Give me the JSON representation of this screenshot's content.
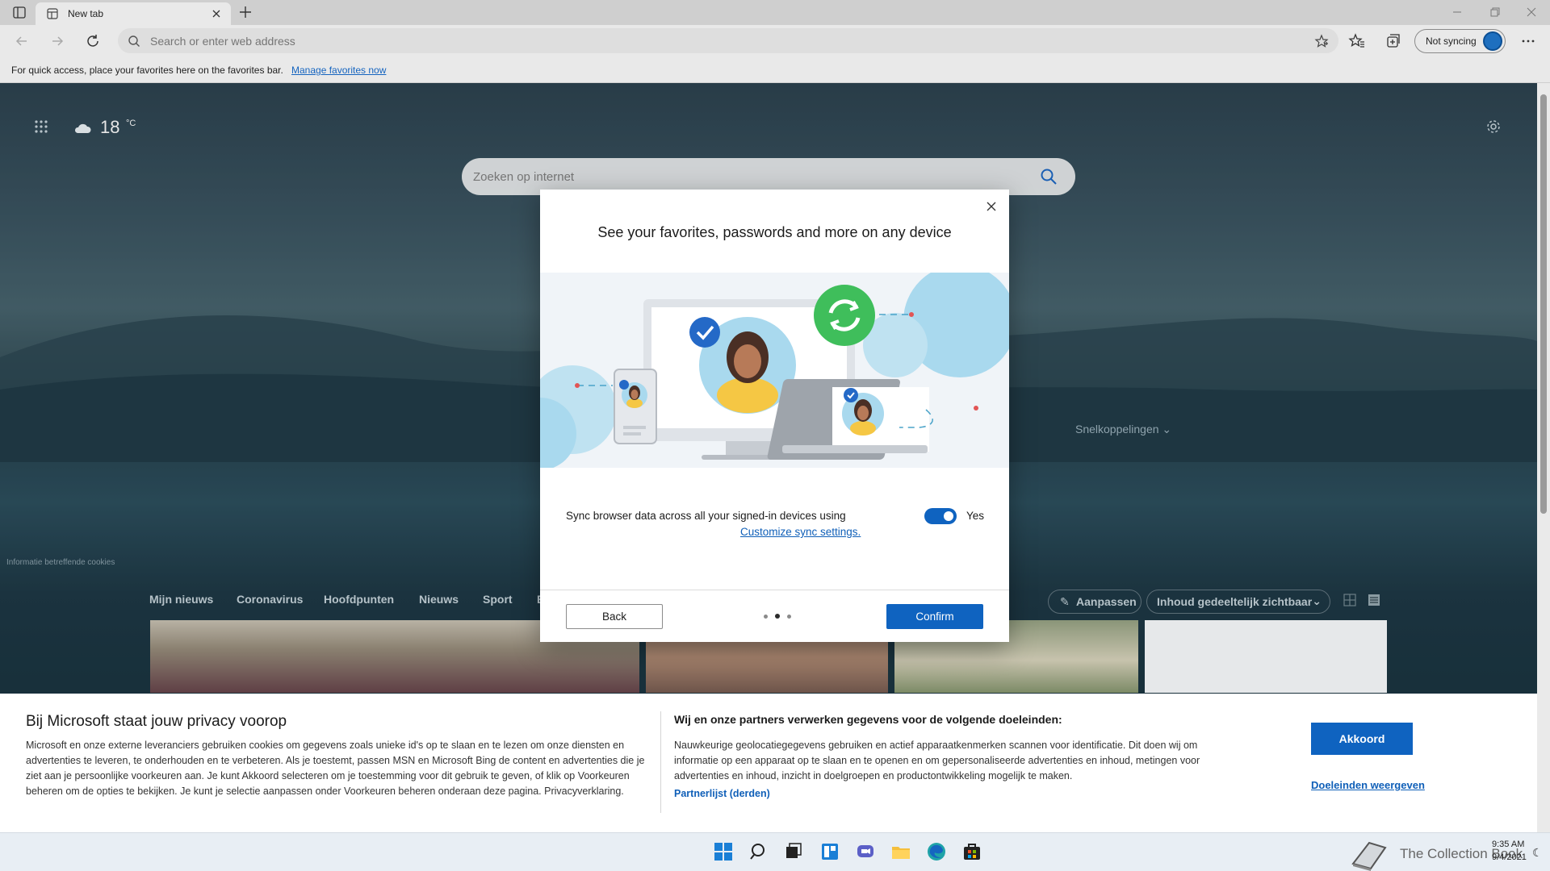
{
  "browser": {
    "tab_title": "New tab",
    "address_placeholder": "Search or enter web address",
    "sync_label": "Not syncing",
    "favbar_text": "For quick access, place your favorites here on the favorites bar.",
    "favbar_link": "Manage favorites now"
  },
  "ntp": {
    "temperature": "18",
    "temperature_unit": "°C",
    "search_placeholder": "Zoeken op internet",
    "quicklinks": "Snelkoppelingen",
    "cookie_info": "Informatie betreffende cookies",
    "news_tabs": [
      "Mijn nieuws",
      "Coronavirus",
      "Hoofdpunten",
      "Nieuws",
      "Sport",
      "E"
    ],
    "customize_label": "Aanpassen",
    "content_view_label": "Inhoud gedeeltelijk zichtbaar"
  },
  "dialog": {
    "title": "See your favorites, passwords and more on any device",
    "sync_text": "Sync browser data across all your signed-in devices using",
    "sync_link": "Customize sync settings.",
    "toggle_label": "Yes",
    "back_label": "Back",
    "confirm_label": "Confirm",
    "page_current": 2,
    "page_total": 3
  },
  "privacy": {
    "title": "Bij Microsoft staat jouw privacy voorop",
    "body": "Microsoft en onze externe leveranciers gebruiken cookies om gegevens zoals unieke id's op te slaan en te lezen om onze diensten en advertenties te leveren, te onderhouden en te verbeteren. Als je toestemt, passen MSN en Microsoft Bing de content en advertenties die je ziet aan je persoonlijke voorkeuren aan. Je kunt Akkoord selecteren om je toestemming voor dit gebruik te geven, of klik op Voorkeuren beheren om de opties te bekijken. Je kunt je selectie aanpassen onder Voorkeuren beheren onderaan deze pagina. Privacyverklaring.",
    "right_title": "Wij en onze partners verwerken gegevens voor de volgende doeleinden:",
    "right_body": "Nauwkeurige geolocatiegegevens gebruiken en actief apparaatkenmerken scannen voor identificatie. Dit doen wij om informatie op een apparaat op te slaan en te openen en om gepersonaliseerde advertenties en inhoud, metingen voor advertenties en inhoud, inzicht in doelgroepen en productontwikkeling mogelijk te maken.",
    "partner_link": "Partnerlijst (derden)",
    "accept_label": "Akkoord",
    "purposes_link": "Doeleinden weergeven"
  },
  "taskbar": {
    "watermark": "The Collection Book",
    "time": "9:35 AM",
    "date": "9/4/2021"
  },
  "colors": {
    "accent": "#0f63c0",
    "link": "#0f5fb8"
  }
}
